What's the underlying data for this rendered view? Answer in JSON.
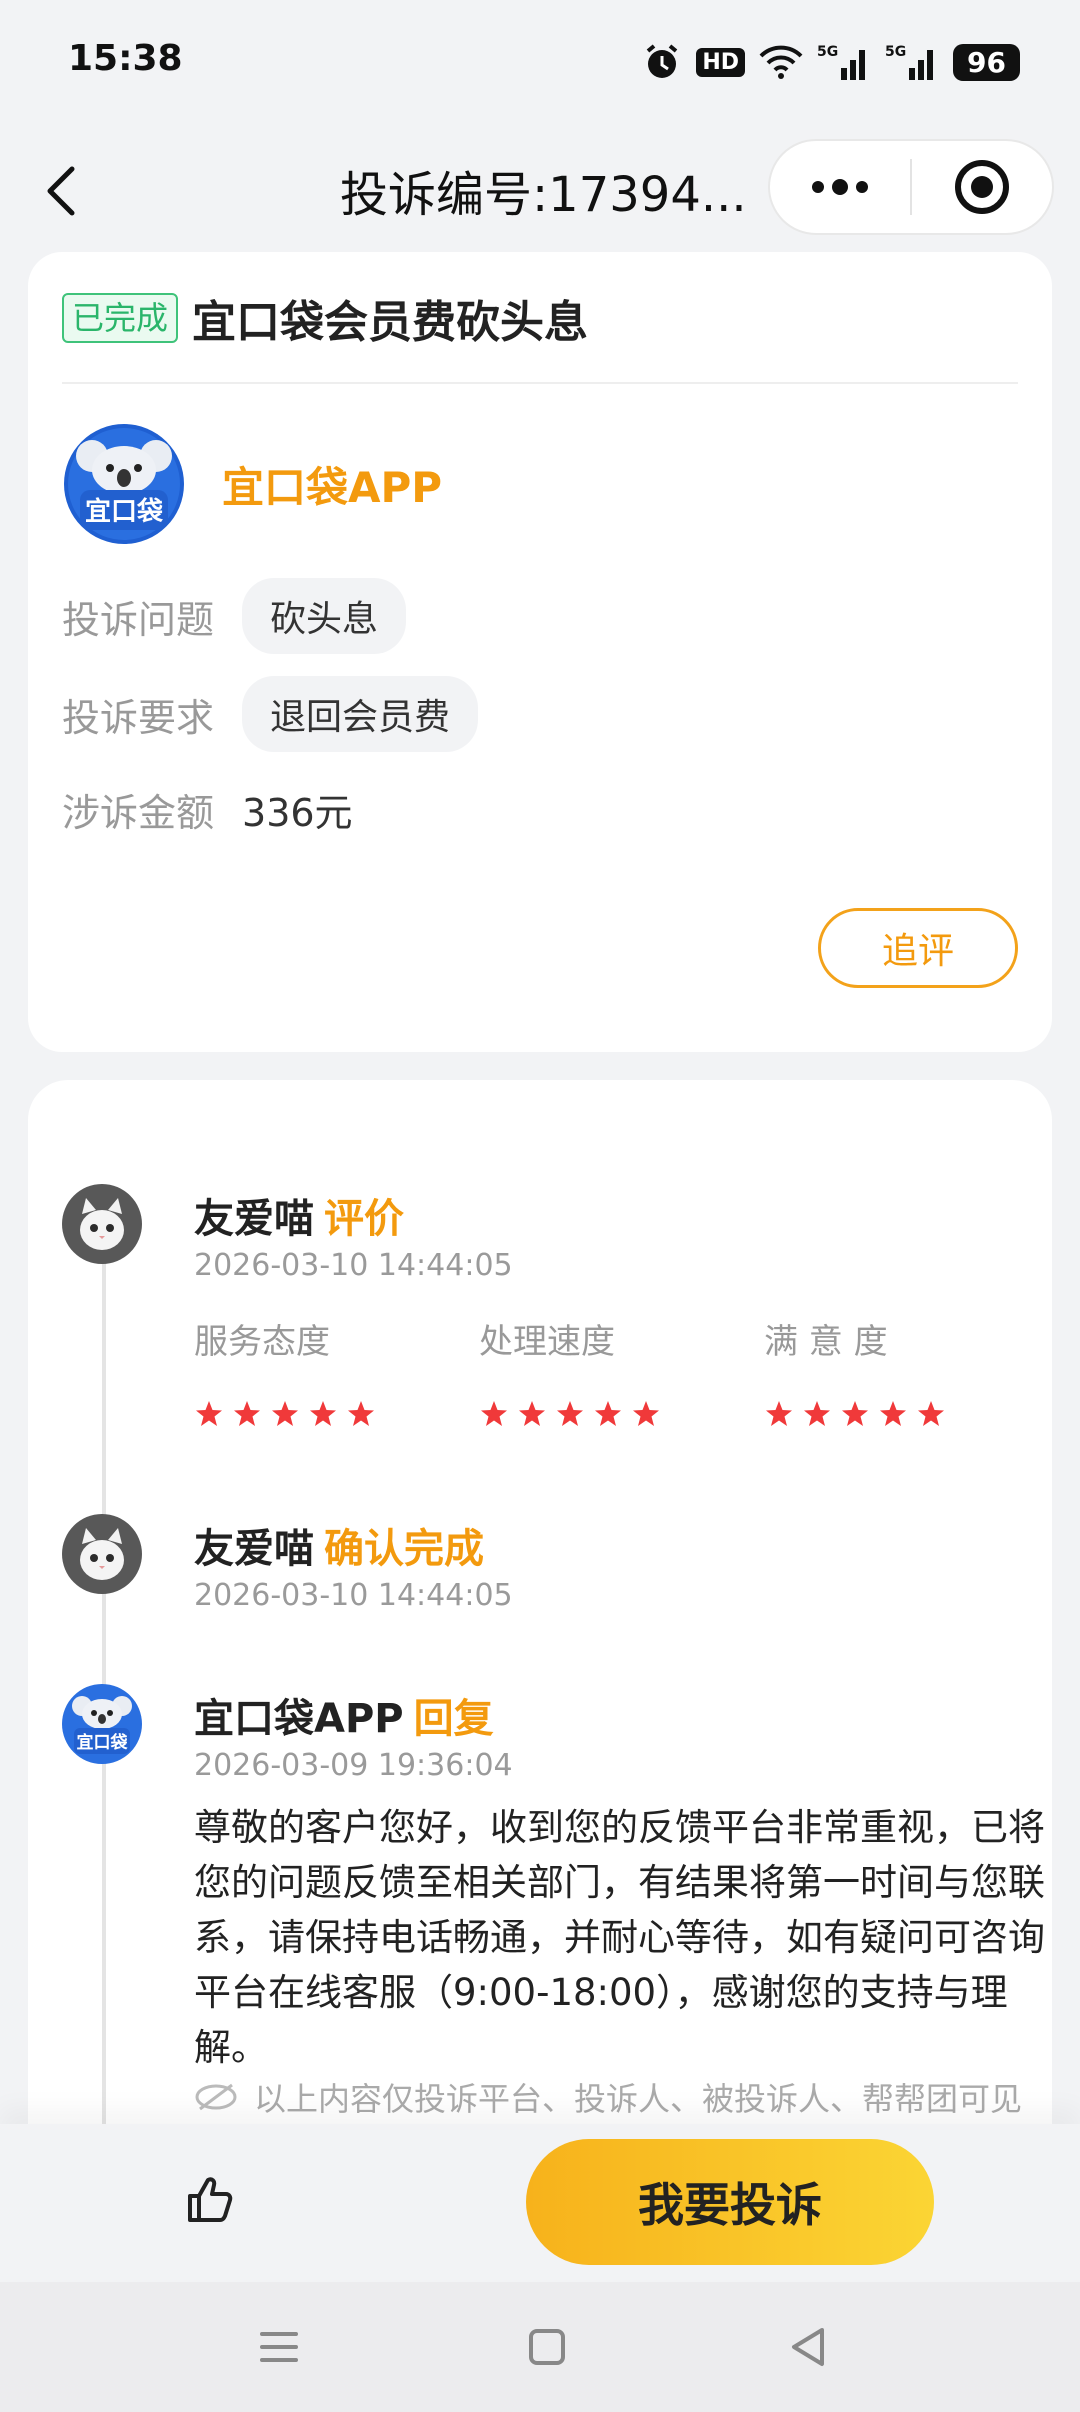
{
  "status_bar": {
    "time": "15:38",
    "hd_label": "HD",
    "battery": "96",
    "icons": [
      "alarm-icon",
      "hd-icon",
      "wifi-icon",
      "signal-5g-icon",
      "signal-5g-icon",
      "battery-icon"
    ]
  },
  "nav": {
    "title": "投诉编号:17394...",
    "icons": [
      "back-icon",
      "more-icon",
      "target-icon"
    ]
  },
  "complaint": {
    "status": "已完成",
    "title": "宜口袋会员费砍头息",
    "company": "宜口袋APP",
    "logo_text": "宜口袋",
    "issue_label": "投诉问题",
    "issue_value": "砍头息",
    "demand_label": "投诉要求",
    "demand_value": "退回会员费",
    "amount_label": "涉诉金额",
    "amount_value": "336元",
    "follow_label": "追评"
  },
  "timeline": [
    {
      "name": "友爱喵",
      "action": "评价",
      "time": "2026-03-10 14:44:05",
      "ratings": [
        {
          "label": "服务态度",
          "stars": 5
        },
        {
          "label": "处理速度",
          "stars": 5
        },
        {
          "label": "满 意 度",
          "stars": 5
        }
      ]
    },
    {
      "name": "友爱喵",
      "action": "确认完成",
      "time": "2026-03-10 14:44:05"
    },
    {
      "name": "宜口袋APP",
      "action": "回复",
      "time": "2026-03-09 19:36:04",
      "text": "尊敬的客户您好，收到您的反馈平台非常重视，已将您的问题反馈至相关部门，有结果将第一时间与您联系，请保持电话畅通，并耐心等待，如有疑问可咨询平台在线客服（9:00-18:00），感谢您的支持与理解。",
      "note": "以上内容仅投诉平台、投诉人、被投诉人、帮帮团可见"
    }
  ],
  "bottom": {
    "complain_label": "我要投诉"
  },
  "colors": {
    "accent": "#f39a0e",
    "star": "#f0393a",
    "status_green": "#2ab56a",
    "button_yellow": "#f7b21b"
  }
}
